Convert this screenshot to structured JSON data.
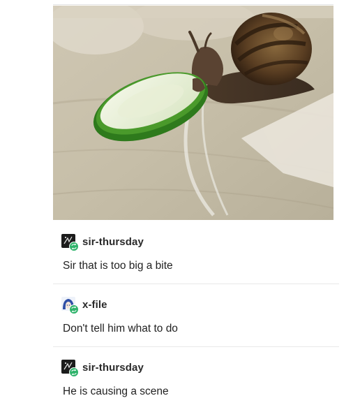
{
  "photo": {
    "icon": "snail-eating-cucumber-photo"
  },
  "posts": [
    {
      "username": "sir-thursday",
      "text": "Sir that is too big a bite",
      "avatar_icon": "dark-avatar-icon"
    },
    {
      "username": "x-file",
      "text": "Don't tell him what to do",
      "avatar_icon": "anime-avatar-icon"
    },
    {
      "username": "sir-thursday",
      "text": "He is causing a scene",
      "avatar_icon": "dark-avatar-icon"
    }
  ],
  "badge_icon": "reblog-icon",
  "colors": {
    "badge": "#2fb36b",
    "divider": "#e8e8e8"
  }
}
